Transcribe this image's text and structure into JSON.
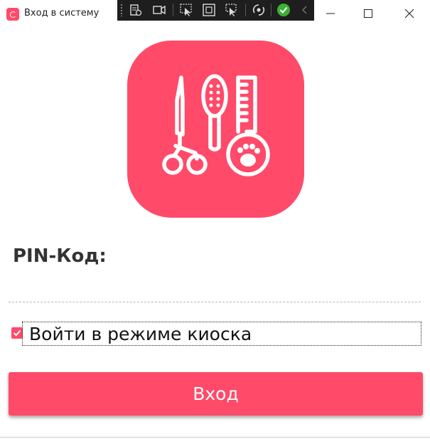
{
  "window": {
    "title": "Вход в систему",
    "controls": [
      "minimize-icon",
      "maximize-icon",
      "close-icon"
    ]
  },
  "devtools_toolbar": {
    "tools": [
      "live-visual-tree-icon",
      "record-icon",
      "select-element-icon",
      "display-layout-adorners-icon",
      "track-focus-icon",
      "hot-reload-icon",
      "hot-reload-status-icon",
      "collapse-icon"
    ],
    "status_color": "#3cb034"
  },
  "logo": {
    "icon": "pet-grooming-icon",
    "background_color": "#ff4a6a"
  },
  "form": {
    "pin_label": "PIN-Код:",
    "pin_value": "",
    "kiosk_checked": true,
    "kiosk_label": "Войти в режиме киоска",
    "submit_label": "Вход"
  },
  "colors": {
    "accent": "#ff4a6a",
    "label_text": "#333333"
  }
}
